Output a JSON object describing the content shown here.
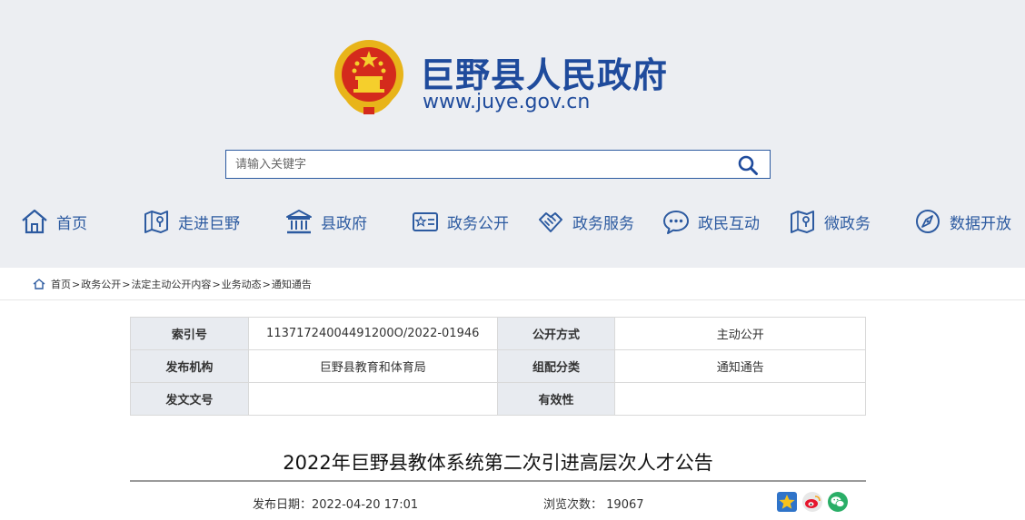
{
  "header": {
    "title": "巨野县人民政府",
    "url": "www.juye.gov.cn"
  },
  "search": {
    "placeholder": "请输入关键字"
  },
  "nav": {
    "items": [
      {
        "label": "首页",
        "icon": "home-icon"
      },
      {
        "label": "走进巨野",
        "icon": "map-icon"
      },
      {
        "label": "县政府",
        "icon": "government-building-icon"
      },
      {
        "label": "政务公开",
        "icon": "id-card-icon"
      },
      {
        "label": "政务服务",
        "icon": "handshake-icon"
      },
      {
        "label": "政民互动",
        "icon": "chat-icon"
      },
      {
        "label": "微政务",
        "icon": "map-icon"
      },
      {
        "label": "数据开放",
        "icon": "compass-icon"
      }
    ]
  },
  "breadcrumb": {
    "items": [
      "首页",
      "政务公开",
      "法定主动公开内容",
      "业务动态",
      "通知通告"
    ],
    "separator": ">"
  },
  "meta": {
    "index_label": "索引号",
    "index_value": "11371724004491200O/2022-01946",
    "open_method_label": "公开方式",
    "open_method_value": "主动公开",
    "publisher_label": "发布机构",
    "publisher_value": "巨野县教育和体育局",
    "category_label": "组配分类",
    "category_value": "通知通告",
    "doc_no_label": "发文文号",
    "doc_no_value": "",
    "validity_label": "有效性",
    "validity_value": ""
  },
  "article": {
    "title": "2022年巨野县教体系统第二次引进高层次人才公告",
    "pubdate_label": "发布日期：",
    "pubdate_value": "2022-04-20 17:01",
    "views_label": "浏览次数：",
    "views_value": "19067"
  },
  "share": {
    "icons": [
      "favorite-star-icon",
      "weibo-icon",
      "wechat-icon"
    ]
  },
  "colors": {
    "brand_blue": "#1f4b9c",
    "nav_blue": "#2c5aa0",
    "header_bg": "#eceef2",
    "table_key_bg": "#e8ebf0"
  }
}
